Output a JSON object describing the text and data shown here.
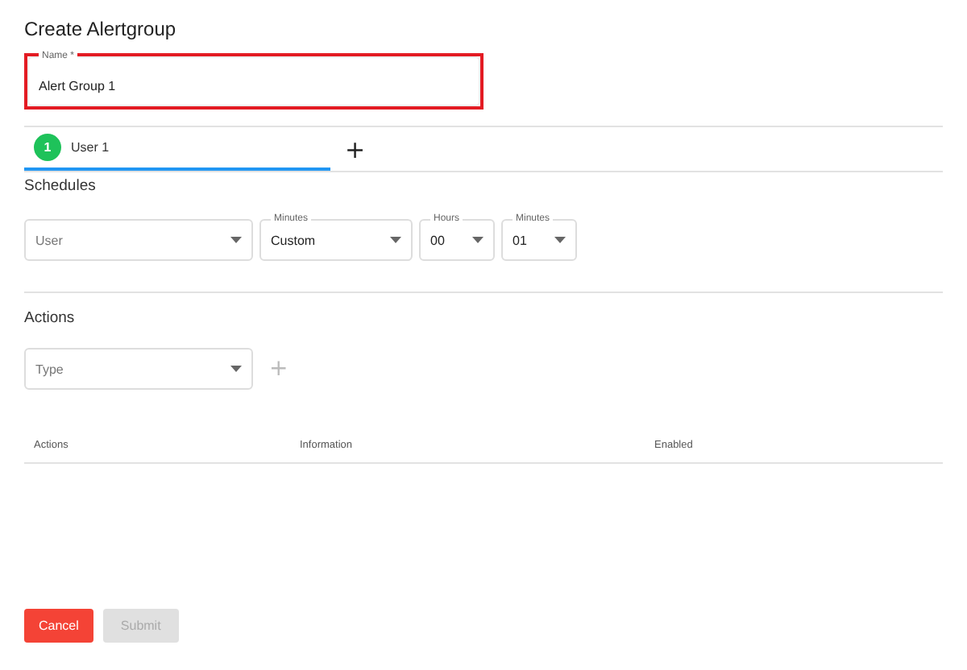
{
  "title": "Create Alertgroup",
  "name_field": {
    "label": "Name *",
    "value": "Alert Group 1",
    "highlighted": true
  },
  "tabs": [
    {
      "number": "1",
      "label": "User 1",
      "selected": true
    }
  ],
  "add_tab": "+",
  "schedules": {
    "heading": "Schedules",
    "fields": [
      {
        "placeholder": "User"
      },
      {
        "label": "Minutes",
        "value": "Custom"
      },
      {
        "label": "Hours",
        "value": "00"
      },
      {
        "label": "Minutes",
        "value": "01"
      }
    ]
  },
  "actions": {
    "heading": "Actions",
    "type_field": {
      "placeholder": "Type"
    },
    "add": "+",
    "table": {
      "columns": [
        "Actions",
        "Information",
        "Enabled"
      ]
    }
  },
  "buttons": [
    {
      "label": "Cancel",
      "kind": "danger",
      "disabled": false
    },
    {
      "label": "Submit",
      "kind": "primary",
      "disabled": true
    }
  ]
}
